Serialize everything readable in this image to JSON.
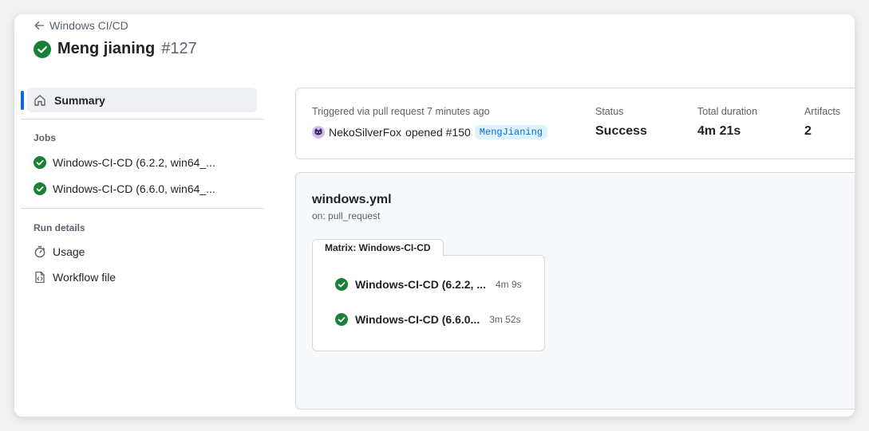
{
  "header": {
    "back_label": "Windows CI/CD",
    "title": "Meng jianing",
    "run_number": "#127"
  },
  "sidebar": {
    "summary_label": "Summary",
    "jobs_heading": "Jobs",
    "jobs": [
      {
        "label": "Windows-CI-CD (6.2.2, win64_..."
      },
      {
        "label": "Windows-CI-CD (6.6.0, win64_..."
      }
    ],
    "run_details_heading": "Run details",
    "usage_label": "Usage",
    "workflow_file_label": "Workflow file"
  },
  "summary": {
    "trigger_text": "Triggered via pull request 7 minutes ago",
    "actor": "NekoSilverFox",
    "action": "opened #150",
    "branch": "MengJianing",
    "status_label": "Status",
    "status_value": "Success",
    "duration_label": "Total duration",
    "duration_value": "4m 21s",
    "artifacts_label": "Artifacts",
    "artifacts_value": "2"
  },
  "graph": {
    "workflow_name": "windows.yml",
    "workflow_trigger": "on: pull_request",
    "matrix_label": "Matrix: Windows-CI-CD",
    "jobs": [
      {
        "label": "Windows-CI-CD (6.2.2, ...",
        "duration": "4m 9s"
      },
      {
        "label": "Windows-CI-CD (6.6.0...",
        "duration": "3m 52s"
      }
    ]
  },
  "colors": {
    "success": "#1a7f37",
    "accent": "#0969da"
  }
}
